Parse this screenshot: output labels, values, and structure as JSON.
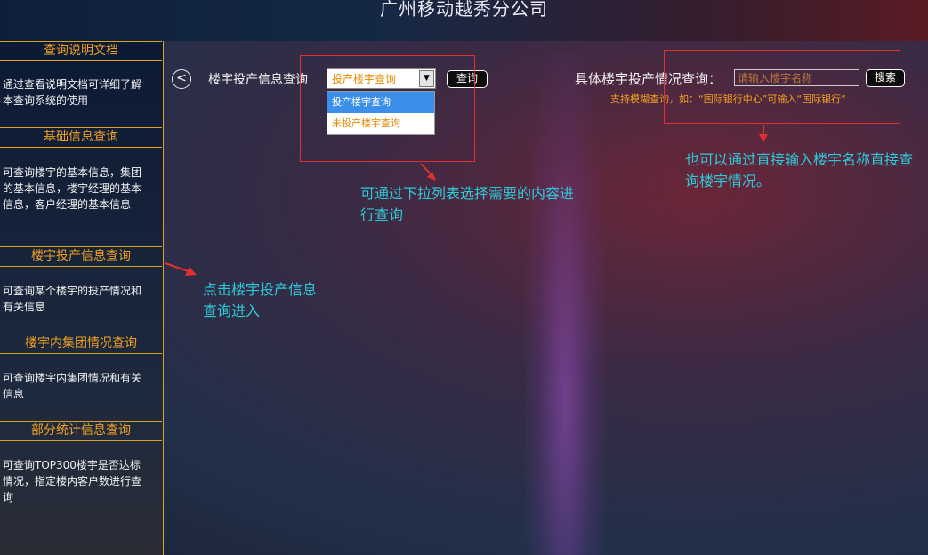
{
  "header": {
    "title": "广州移动越秀分公司"
  },
  "sidebar": {
    "sections": [
      {
        "title": "查询说明文档",
        "desc": "通过查看说明文档可详细了解本查询系统的使用"
      },
      {
        "title": "基础信息查询",
        "desc": "可查询楼宇的基本信息，集团的基本信息，楼宇经理的基本信息，客户经理的基本信息"
      },
      {
        "title": "楼宇投产信息查询",
        "desc": "可查询某个楼宇的投产情况和有关信息"
      },
      {
        "title": "楼宇内集团情况查询",
        "desc": "可查询楼宇内集团情况和有关信息"
      },
      {
        "title": "部分统计信息查询",
        "desc": "可查询TOP300楼宇是否达标情况，指定楼内客户数进行查询"
      }
    ]
  },
  "toolbar": {
    "back_symbol": "<",
    "query_label": "楼宇投产信息查询",
    "select_value": "投产楼宇查询",
    "select_options": [
      "投产楼宇查询",
      "未投产楼宇查询"
    ],
    "query_button": "查询",
    "search_label": "具体楼宇投产情况查询：",
    "search_placeholder": "请输入楼宇名称",
    "search_button": "搜索",
    "search_hint": "支持模糊查询，如：“国际银行中心”可输入“国际银行”"
  },
  "annotations": {
    "dropdown_note": "可通过下拉列表选择需要的内容进行查询",
    "search_note": "也可以通过直接输入楼宇名称直接查询楼宇情况。",
    "sidebar_note": "点击楼宇投产信息查询进入"
  },
  "colors": {
    "accent": "#f0a020",
    "annotation": "#2ec9d8",
    "highlight_box": "#e03030"
  }
}
